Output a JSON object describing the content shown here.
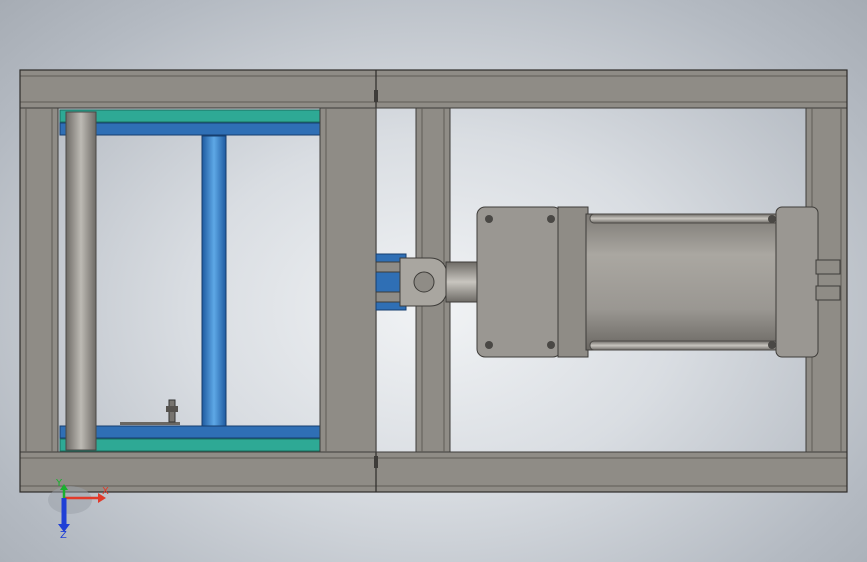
{
  "viewport": {
    "name": "3d-model-viewport"
  },
  "triad": {
    "x_label": "X",
    "y_label": "Y",
    "z_label": "Z"
  },
  "colors": {
    "frame": "#8f8c86",
    "frame_dark": "#5f5c57",
    "teal_plate": "#2ea995",
    "blue_rail": "#2f6fb5",
    "blue_rod": "#3a8ad1",
    "cylinder_body": "#9a9792",
    "axis_x": "#e23a2a",
    "axis_y": "#19b02e",
    "axis_z": "#1f3fd6"
  }
}
